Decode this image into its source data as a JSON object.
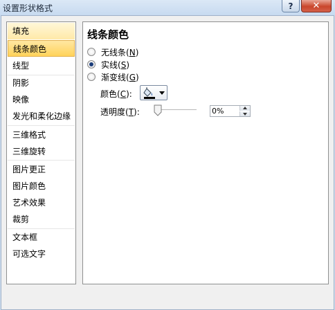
{
  "window": {
    "title": "设置形状格式",
    "help_label": "?",
    "close_label": "✕"
  },
  "nav": {
    "items": [
      {
        "label": "填充"
      },
      {
        "label": "线条颜色"
      },
      {
        "label": "线型"
      },
      {
        "label": "阴影"
      },
      {
        "label": "映像"
      },
      {
        "label": "发光和柔化边缘"
      },
      {
        "label": "三维格式"
      },
      {
        "label": "三维旋转"
      },
      {
        "label": "图片更正"
      },
      {
        "label": "图片颜色"
      },
      {
        "label": "艺术效果"
      },
      {
        "label": "裁剪"
      },
      {
        "label": "文本框"
      },
      {
        "label": "可选文字"
      }
    ],
    "selected": "线条颜色",
    "hovered": "填充"
  },
  "panel": {
    "title": "线条颜色",
    "options": [
      {
        "label": "无线条",
        "key": "N",
        "checked": false
      },
      {
        "label": "实线",
        "key": "S",
        "checked": true
      },
      {
        "label": "渐变线",
        "key": "G",
        "checked": false
      }
    ],
    "color_label": "颜色",
    "color_key": "C",
    "color_icon": "paint-bucket-icon",
    "transparency_label": "透明度",
    "transparency_key": "T",
    "transparency_value": "0%",
    "transparency_slider": 0
  }
}
